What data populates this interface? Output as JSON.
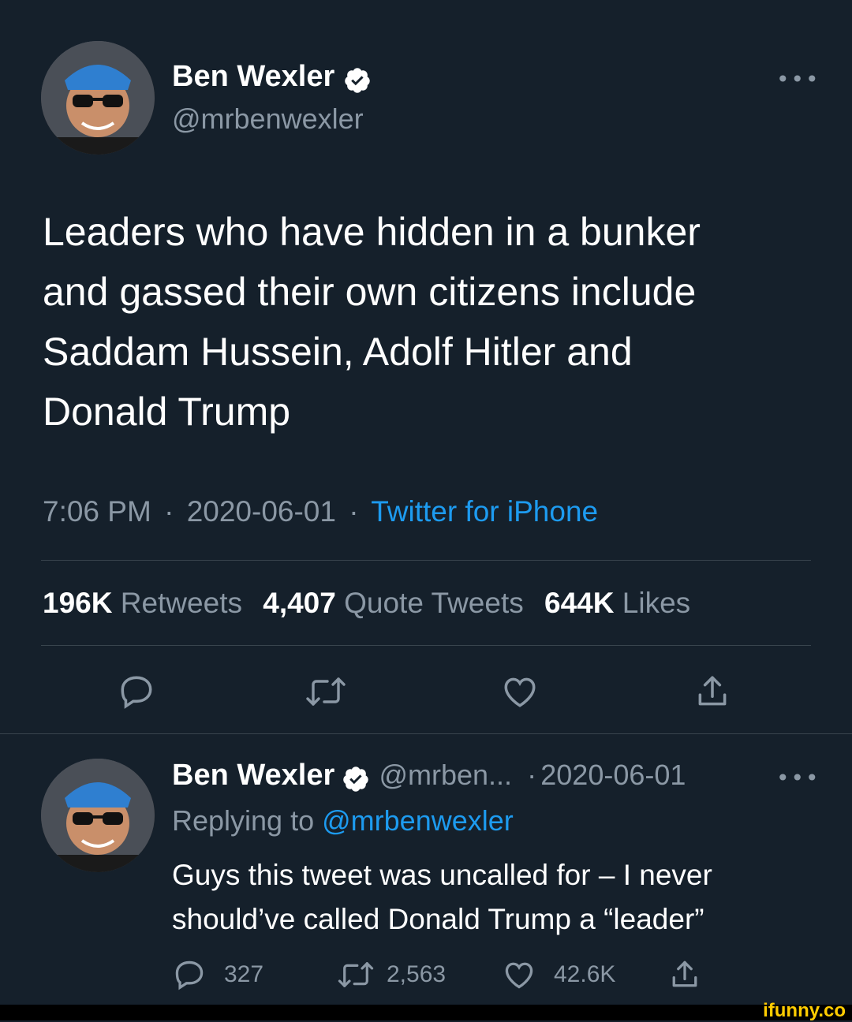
{
  "main_tweet": {
    "author_name": "Ben Wexler",
    "author_handle": "@mrbenwexler",
    "more_label": "•••",
    "text_lines": [
      "Leaders who have hidden in a bunker",
      "and gassed their own citizens include",
      "Saddam Hussein, Adolf Hitler and",
      "Donald Trump"
    ],
    "time": "7:06 PM",
    "separator": "·",
    "date": "2020-06-01",
    "source": "Twitter for iPhone",
    "stats": {
      "retweets_count": "196K",
      "retweets_label": "Retweets",
      "quotes_count": "4,407",
      "quotes_label": "Quote Tweets",
      "likes_count": "644K",
      "likes_label": "Likes"
    }
  },
  "reply_tweet": {
    "author_name": "Ben Wexler",
    "author_handle": "@mrben...",
    "separator": "·",
    "date": "2020-06-01",
    "more_label": "•••",
    "replying_prefix": "Replying to",
    "replying_handle": "@mrbenwexler",
    "text_lines": [
      "Guys this tweet was uncalled for – I never",
      "should’ve called Donald Trump a “leader”"
    ],
    "reply_count": "327",
    "retweet_count": "2,563",
    "like_count": "42.6K"
  },
  "watermark": "ifunny.co",
  "colors": {
    "background": "#15202b",
    "secondary_text": "#8b98a5",
    "link": "#1d9bf0",
    "divider": "#38444d",
    "watermark": "#ffcc00"
  },
  "icons": [
    "verified-badge-icon",
    "reply-icon",
    "retweet-icon",
    "like-icon",
    "share-icon",
    "more-icon"
  ]
}
